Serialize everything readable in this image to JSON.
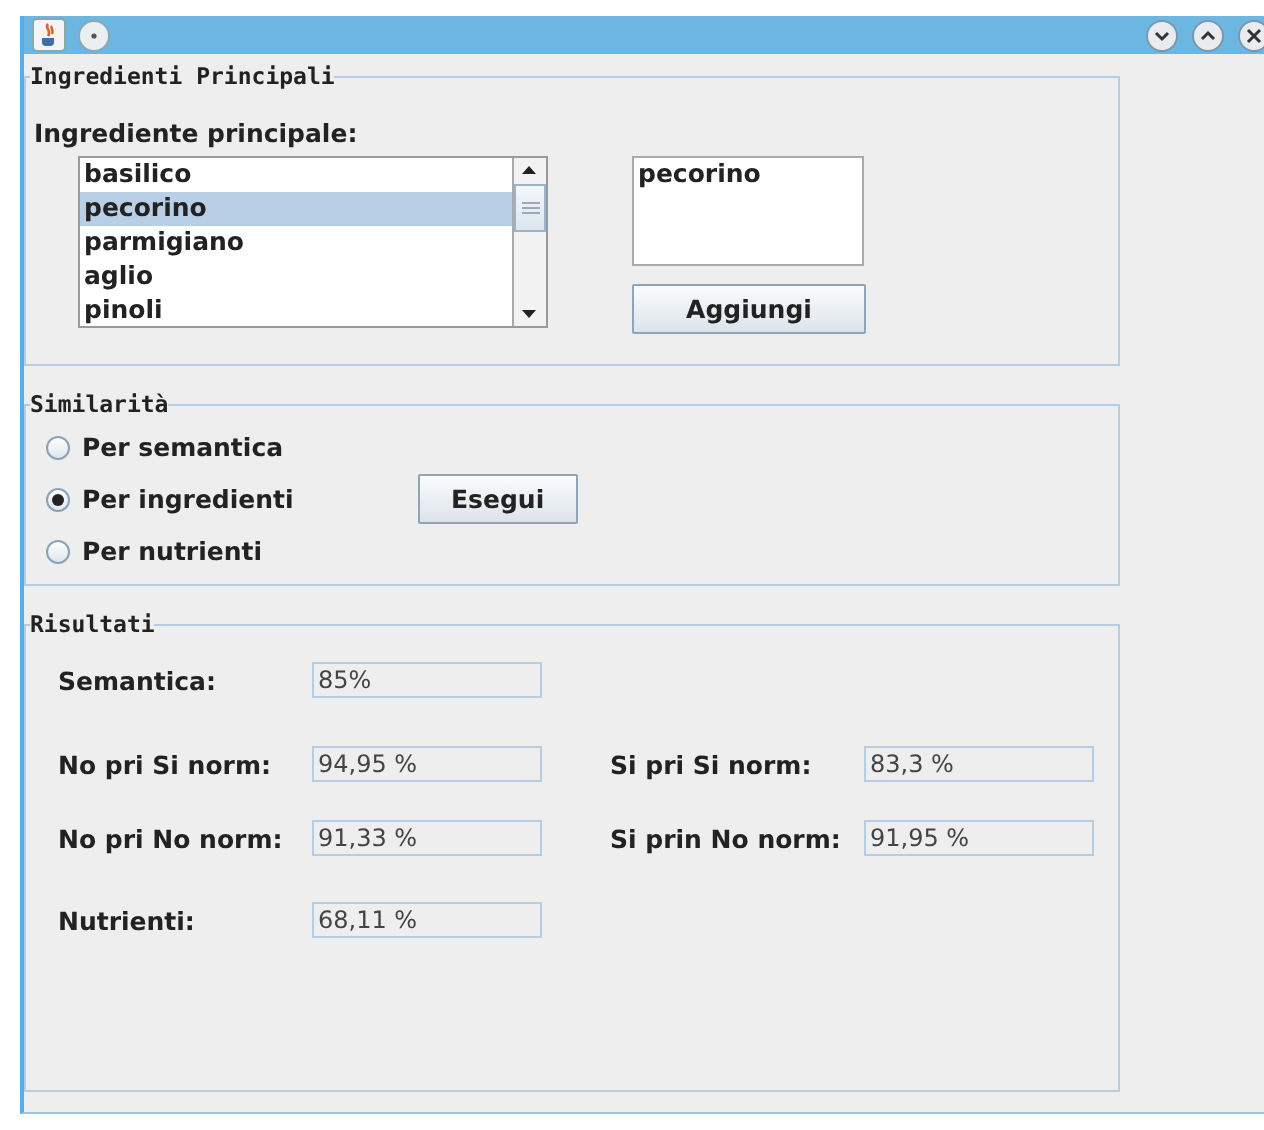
{
  "ingredients_panel": {
    "title": "Ingredienti Principali",
    "label": "Ingrediente principale:",
    "list": [
      {
        "text": "basilico",
        "selected": false
      },
      {
        "text": "pecorino",
        "selected": true
      },
      {
        "text": "parmigiano",
        "selected": false
      },
      {
        "text": "aglio",
        "selected": false
      },
      {
        "text": "pinoli",
        "selected": false
      }
    ],
    "selection_box": {
      "value": "pecorino"
    },
    "add_button": "Aggiungi"
  },
  "similarity_panel": {
    "title": "Similarità",
    "options": [
      {
        "label": "Per semantica",
        "selected": false
      },
      {
        "label": "Per ingredienti",
        "selected": true
      },
      {
        "label": "Per nutrienti",
        "selected": false
      }
    ],
    "run_button": "Esegui"
  },
  "results_panel": {
    "title": "Risultati",
    "rows": [
      [
        {
          "label": "Semantica:",
          "value": "85%"
        }
      ],
      [
        {
          "label": "No pri Si norm:",
          "value": "94,95 %"
        },
        {
          "label": "Si pri Si norm:",
          "value": "83,3 %"
        }
      ],
      [
        {
          "label": "No pri No norm:",
          "value": "91,33 %"
        },
        {
          "label": "Si prin No norm:",
          "value": "91,95 %"
        }
      ],
      [
        {
          "label": "Nutrienti:",
          "value": "68,11 %"
        }
      ]
    ]
  }
}
